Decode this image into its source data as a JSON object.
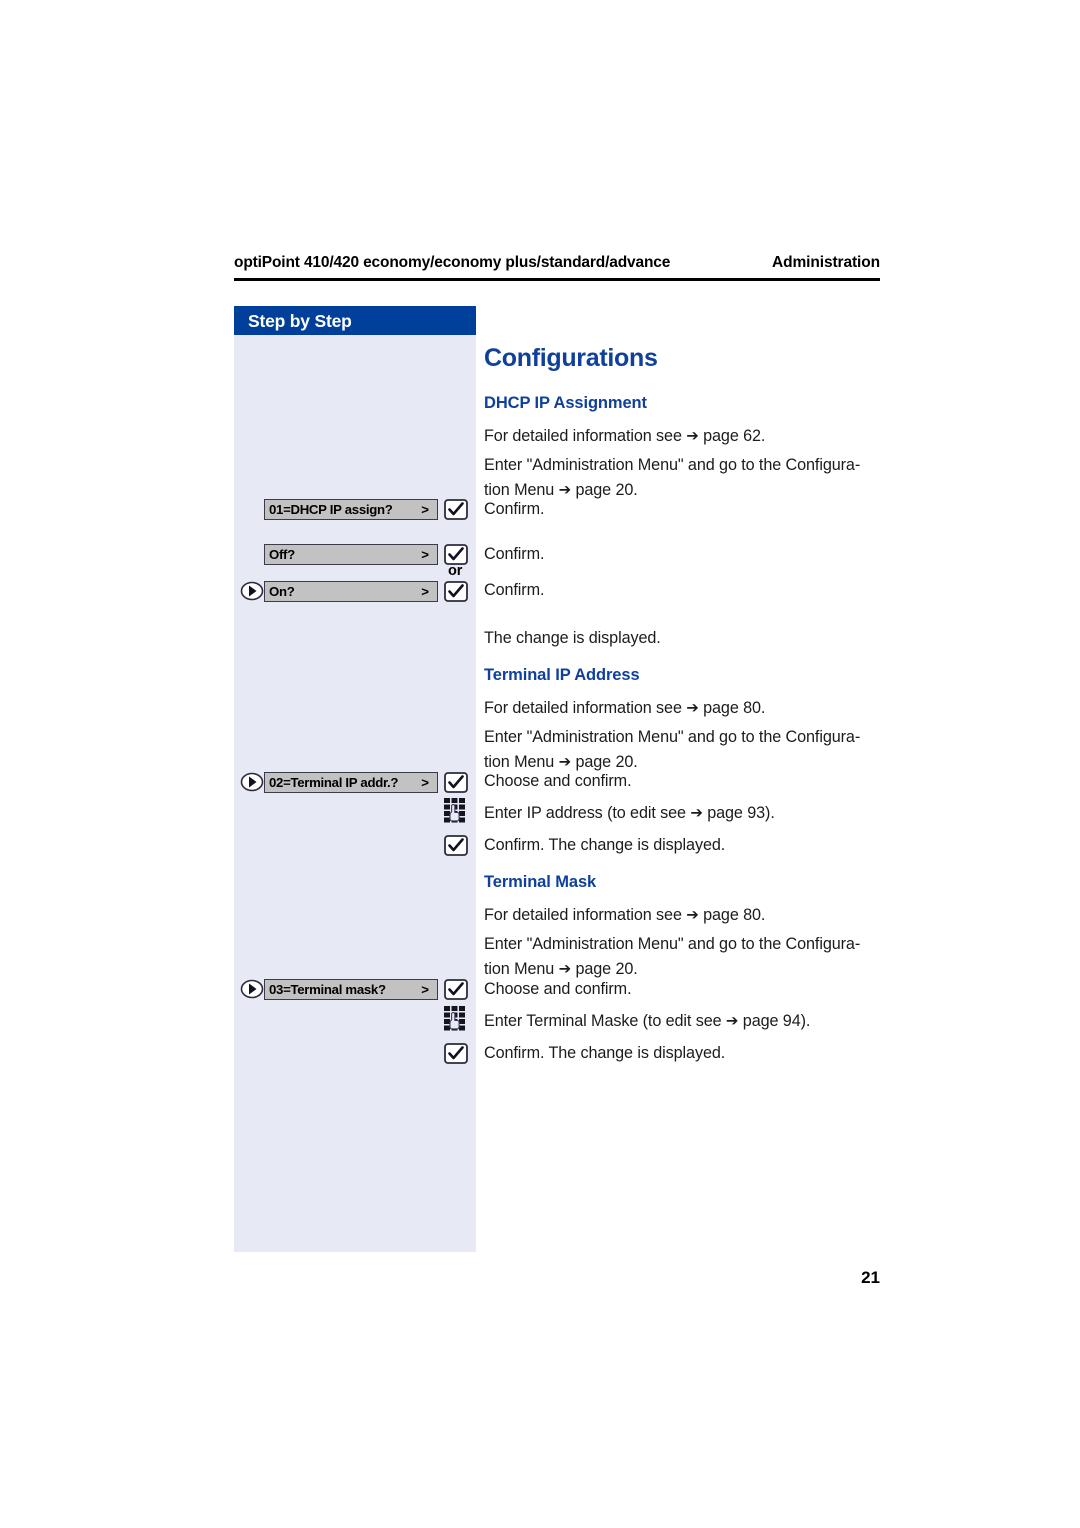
{
  "header": {
    "left": "optiPoint 410/420 economy/economy plus/standard/advance",
    "right": "Administration"
  },
  "sidebar": {
    "title": "Step by Step"
  },
  "page_title": "Configurations",
  "folio": "21",
  "icons": {
    "check": "checkmark-box-icon",
    "keypad": "keypad-icon",
    "nav": "navigation-rocker-icon"
  },
  "or_label": "or",
  "sections": [
    {
      "heading": "DHCP IP Assignment",
      "intro_1": "For detailed information see ",
      "intro_1_arrow": "➔",
      "intro_1_tail": " page 62.",
      "intro_2": "Enter \"Administration Menu\" and go to the Configura-",
      "intro_2b": "tion Menu ",
      "intro_2_arrow": "➔",
      "intro_2_tail": " page 20.",
      "steps": [
        {
          "display": "01=DHCP IP assign?",
          "caret": ">",
          "text": "Confirm."
        },
        {
          "display": "Off?",
          "caret": ">",
          "text": "Confirm."
        },
        {
          "display": "On?",
          "caret": ">",
          "text": "Confirm."
        }
      ],
      "outro": "The change is displayed."
    },
    {
      "heading": "Terminal IP Address",
      "intro_1": "For detailed information see ",
      "intro_1_arrow": "➔",
      "intro_1_tail": " page 80.",
      "intro_2": "Enter \"Administration Menu\" and go to the Configura-",
      "intro_2b": "tion Menu ",
      "intro_2_arrow": "➔",
      "intro_2_tail": " page 20.",
      "steps": [
        {
          "display": "02=Terminal IP addr.?",
          "caret": ">",
          "text": "Choose and confirm."
        }
      ],
      "entry_text_a": "Enter IP address (to edit see ",
      "entry_arrow": "➔",
      "entry_text_b": " page 93).",
      "confirm_text": "Confirm. The change is displayed."
    },
    {
      "heading": "Terminal Mask",
      "intro_1": "For detailed information see ",
      "intro_1_arrow": "➔",
      "intro_1_tail": " page 80.",
      "intro_2": "Enter \"Administration Menu\" and go to the Configura-",
      "intro_2b": "tion Menu ",
      "intro_2_arrow": "➔",
      "intro_2_tail": " page 20.",
      "steps": [
        {
          "display": "03=Terminal mask?",
          "caret": ">",
          "text": "Choose and confirm."
        }
      ],
      "entry_text_a": "Enter Terminal Maske (to edit see ",
      "entry_arrow": "➔",
      "entry_text_b": " page 94).",
      "confirm_text": "Confirm. The change is displayed."
    }
  ],
  "colors": {
    "brand_blue": "#10409b",
    "header_blue": "#00409a",
    "sidebar_bg": "#e7eaf5",
    "display_gray": "#c2c2c2"
  }
}
